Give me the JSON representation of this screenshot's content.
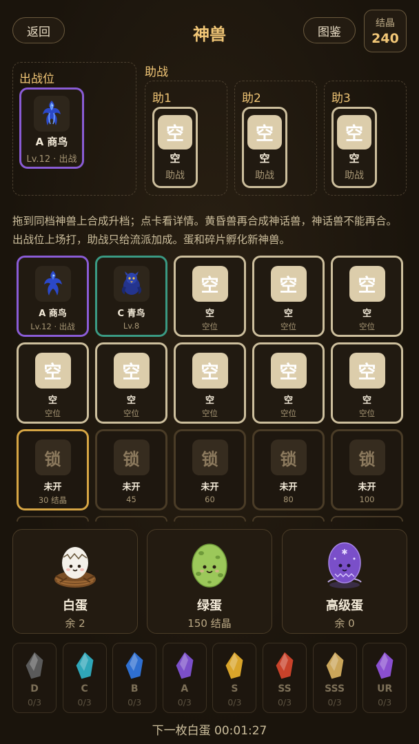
{
  "header": {
    "back_label": "返回",
    "title": "神兽",
    "codex_label": "图鉴",
    "crystal_label": "结晶",
    "crystal_value": "240"
  },
  "battle": {
    "label": "出战位",
    "beast": {
      "name": "A 商鸟",
      "sub": "Lv.12 · 出战",
      "icon": "blue-phoenix-icon"
    }
  },
  "assist": {
    "label": "助战",
    "slots": [
      {
        "label": "助1",
        "icon_text": "空",
        "name": "空",
        "sub": "助战"
      },
      {
        "label": "助2",
        "icon_text": "空",
        "name": "空",
        "sub": "助战"
      },
      {
        "label": "助3",
        "icon_text": "空",
        "name": "空",
        "sub": "助战"
      }
    ]
  },
  "description": "拖到同档神兽上合成升档；点卡看详情。黄昏兽再合成神话兽，神话兽不能再合。出战位上场打，助战只给流派加成。蛋和碎片孵化新神兽。",
  "grid": {
    "row1": [
      {
        "kind": "beast",
        "border": "purple",
        "icon": "blue-phoenix-icon",
        "name": "A 商鸟",
        "sub": "Lv.12 · 出战"
      },
      {
        "kind": "beast",
        "border": "teal",
        "icon": "blue-bird-icon",
        "name": "C 青鸟",
        "sub": "Lv.8"
      },
      {
        "kind": "empty",
        "icon_text": "空",
        "name": "空",
        "sub": "空位"
      },
      {
        "kind": "empty",
        "icon_text": "空",
        "name": "空",
        "sub": "空位"
      },
      {
        "kind": "empty",
        "icon_text": "空",
        "name": "空",
        "sub": "空位"
      }
    ],
    "row2": [
      {
        "kind": "empty",
        "icon_text": "空",
        "name": "空",
        "sub": "空位"
      },
      {
        "kind": "empty",
        "icon_text": "空",
        "name": "空",
        "sub": "空位"
      },
      {
        "kind": "empty",
        "icon_text": "空",
        "name": "空",
        "sub": "空位"
      },
      {
        "kind": "empty",
        "icon_text": "空",
        "name": "空",
        "sub": "空位"
      },
      {
        "kind": "empty",
        "icon_text": "空",
        "name": "空",
        "sub": "空位"
      }
    ],
    "row3": [
      {
        "kind": "lock",
        "border": "gold",
        "icon_text": "锁",
        "name": "未开",
        "sub": "30 结晶"
      },
      {
        "kind": "lock",
        "icon_text": "锁",
        "name": "未开",
        "sub": "45"
      },
      {
        "kind": "lock",
        "icon_text": "锁",
        "name": "未开",
        "sub": "60"
      },
      {
        "kind": "lock",
        "icon_text": "锁",
        "name": "未开",
        "sub": "80"
      },
      {
        "kind": "lock",
        "icon_text": "锁",
        "name": "未开",
        "sub": "100"
      }
    ]
  },
  "eggs": [
    {
      "name": "白蛋",
      "sub": "余 2",
      "icon": "white-egg-nest-icon"
    },
    {
      "name": "绿蛋",
      "sub": "150 结晶",
      "icon": "green-egg-icon"
    },
    {
      "name": "高级蛋",
      "sub": "余 0",
      "icon": "purple-rune-egg-icon"
    }
  ],
  "fragments": [
    {
      "grade": "D",
      "count": "0/3",
      "color": "#5a5a5a"
    },
    {
      "grade": "C",
      "count": "0/3",
      "color": "#2fa6b8"
    },
    {
      "grade": "B",
      "count": "0/3",
      "color": "#2f6fd0"
    },
    {
      "grade": "A",
      "count": "0/3",
      "color": "#7b4fc9"
    },
    {
      "grade": "S",
      "count": "0/3",
      "color": "#d9a42a"
    },
    {
      "grade": "SS",
      "count": "0/3",
      "color": "#c8422a"
    },
    {
      "grade": "SSS",
      "count": "0/3",
      "color": "#caa55a"
    },
    {
      "grade": "UR",
      "count": "0/3",
      "color": "#8a4fd0"
    }
  ],
  "timer": "下一枚白蛋 00:01:27"
}
